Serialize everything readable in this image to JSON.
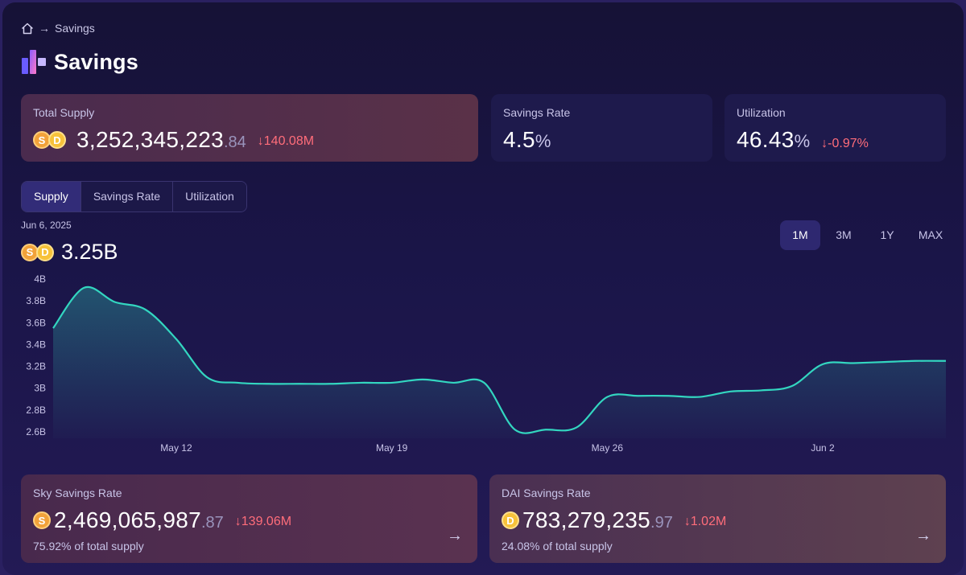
{
  "breadcrumb": {
    "home_icon": "home-icon",
    "current": "Savings"
  },
  "page": {
    "title": "Savings"
  },
  "stats": {
    "total_supply": {
      "label": "Total Supply",
      "int": "3,252,345,223",
      "dec": ".84",
      "change": "↓140.08M"
    },
    "savings_rate": {
      "label": "Savings Rate",
      "value": "4.5",
      "unit": "%"
    },
    "utilization": {
      "label": "Utilization",
      "value": "46.43",
      "unit": "%",
      "change": "↓-0.97%"
    }
  },
  "tabs": [
    {
      "label": "Supply",
      "active": true
    },
    {
      "label": "Savings Rate",
      "active": false
    },
    {
      "label": "Utilization",
      "active": false
    }
  ],
  "chart_header": {
    "date": "Jun 6, 2025",
    "value": "3.25B"
  },
  "ranges": [
    {
      "label": "1M",
      "active": true
    },
    {
      "label": "3M",
      "active": false
    },
    {
      "label": "1Y",
      "active": false
    },
    {
      "label": "MAX",
      "active": false
    }
  ],
  "chart_data": {
    "type": "area",
    "x": [
      "May 8",
      "May 9",
      "May 10",
      "May 11",
      "May 12",
      "May 13",
      "May 14",
      "May 15",
      "May 16",
      "May 17",
      "May 18",
      "May 19",
      "May 20",
      "May 21",
      "May 22",
      "May 23",
      "May 24",
      "May 25",
      "May 26",
      "May 27",
      "May 28",
      "May 29",
      "May 30",
      "May 31",
      "Jun 1",
      "Jun 2",
      "Jun 3",
      "Jun 4",
      "Jun 5",
      "Jun 6"
    ],
    "series": [
      {
        "values": [
          3.55,
          3.92,
          3.79,
          3.72,
          3.45,
          3.1,
          3.05,
          3.04,
          3.04,
          3.04,
          3.05,
          3.05,
          3.08,
          3.05,
          3.05,
          2.62,
          2.62,
          2.64,
          2.92,
          2.93,
          2.93,
          2.92,
          2.97,
          2.98,
          3.02,
          3.22,
          3.23,
          3.24,
          3.25,
          3.25
        ]
      }
    ],
    "xticks": [
      "May 12",
      "May 19",
      "May 26",
      "Jun 2"
    ],
    "yticks": [
      "4B",
      "3.8B",
      "3.6B",
      "3.4B",
      "3.2B",
      "3B",
      "2.8B",
      "2.6B"
    ],
    "ylim": [
      2.6,
      4.0
    ],
    "color": "#33d6c0",
    "grid": false
  },
  "bottom": {
    "sky": {
      "label": "Sky Savings Rate",
      "int": "2,469,065,987",
      "dec": ".87",
      "change": "↓139.06M",
      "sub": "75.92% of total supply",
      "arrow": "→"
    },
    "dai": {
      "label": "DAI Savings Rate",
      "int": "783,279,235",
      "dec": ".97",
      "change": "↓1.02M",
      "sub": "24.08% of total supply",
      "arrow": "→"
    }
  },
  "colors": {
    "accent": "#33d6c0",
    "negative": "#ff6d7a",
    "active_tab": "#322c78"
  }
}
